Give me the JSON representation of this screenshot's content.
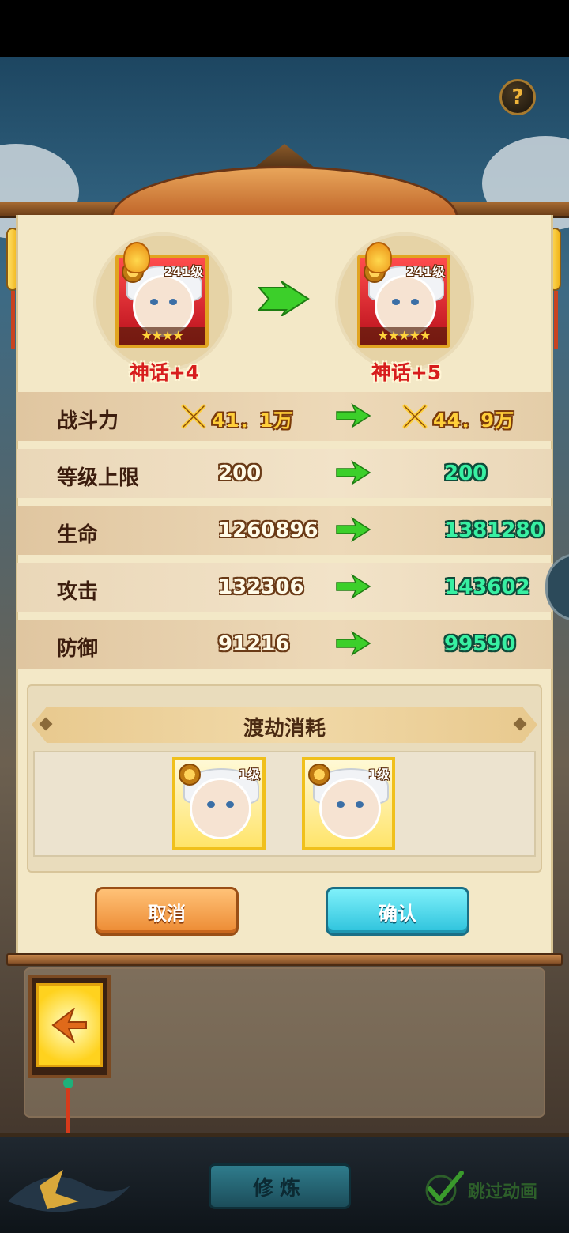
{
  "help": {
    "label": "?"
  },
  "before": {
    "level": "241级",
    "tier": "神话+4",
    "stars": "★★★★"
  },
  "after": {
    "level": "241级",
    "tier": "神话+5",
    "stars": "★★★★★"
  },
  "stats": {
    "power": {
      "label": "战斗力",
      "old": "41．1万",
      "new": "44．9万"
    },
    "level_cap": {
      "label": "等级上限",
      "old": "200",
      "new": "200"
    },
    "hp": {
      "label": "生命",
      "old": "1260896",
      "new": "1381280"
    },
    "attack": {
      "label": "攻击",
      "old": "132306",
      "new": "143602"
    },
    "defense": {
      "label": "防御",
      "old": "91216",
      "new": "99590"
    }
  },
  "cost": {
    "title": "渡劫消耗",
    "items": [
      {
        "level": "1级"
      },
      {
        "level": "1级"
      }
    ]
  },
  "buttons": {
    "cancel": "取消",
    "confirm": "确认"
  },
  "bottom": {
    "train": "修炼",
    "skip": "跳过动画"
  },
  "colors": {
    "new_value": "#38f0a2",
    "tier_red": "#d71d1d",
    "arrow_green": "#3ccf2a"
  }
}
